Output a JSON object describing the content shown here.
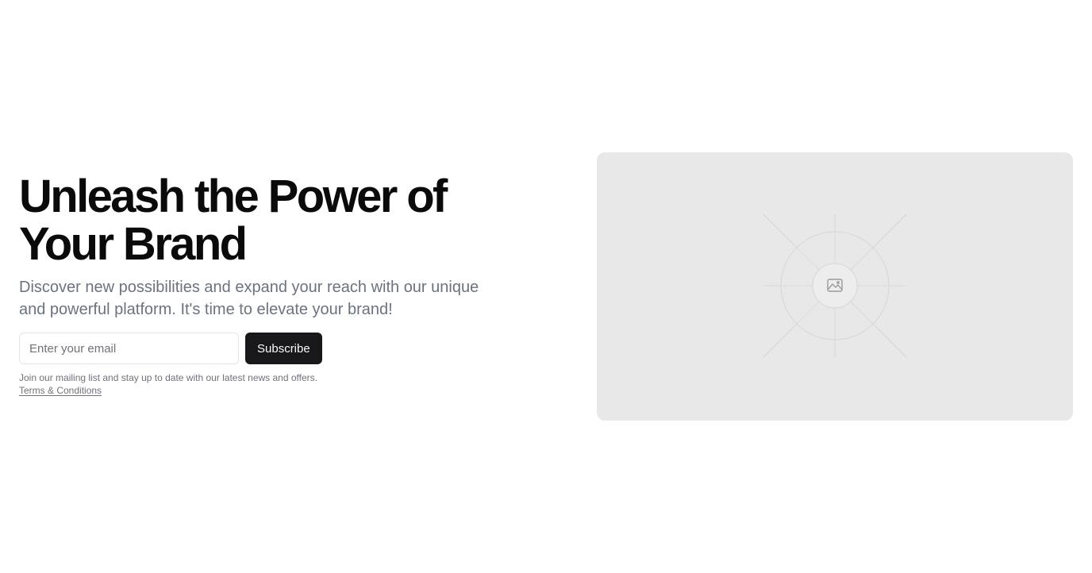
{
  "hero": {
    "headline": "Unleash the Power of Your Brand",
    "subheadline": "Discover new possibilities and expand your reach with our unique and powerful platform. It's time to elevate your brand!",
    "email_placeholder": "Enter your email",
    "email_value": "",
    "subscribe_label": "Subscribe",
    "fine_print": "Join our mailing list and stay up to date with our latest news and offers.",
    "terms_label": "Terms & Conditions"
  },
  "media": {
    "icon": "image-placeholder-icon",
    "background_color": "#e8e8e8"
  },
  "colors": {
    "primary_button": "#18181b",
    "headline": "#0a0a0a",
    "muted_text": "#6b7280"
  }
}
